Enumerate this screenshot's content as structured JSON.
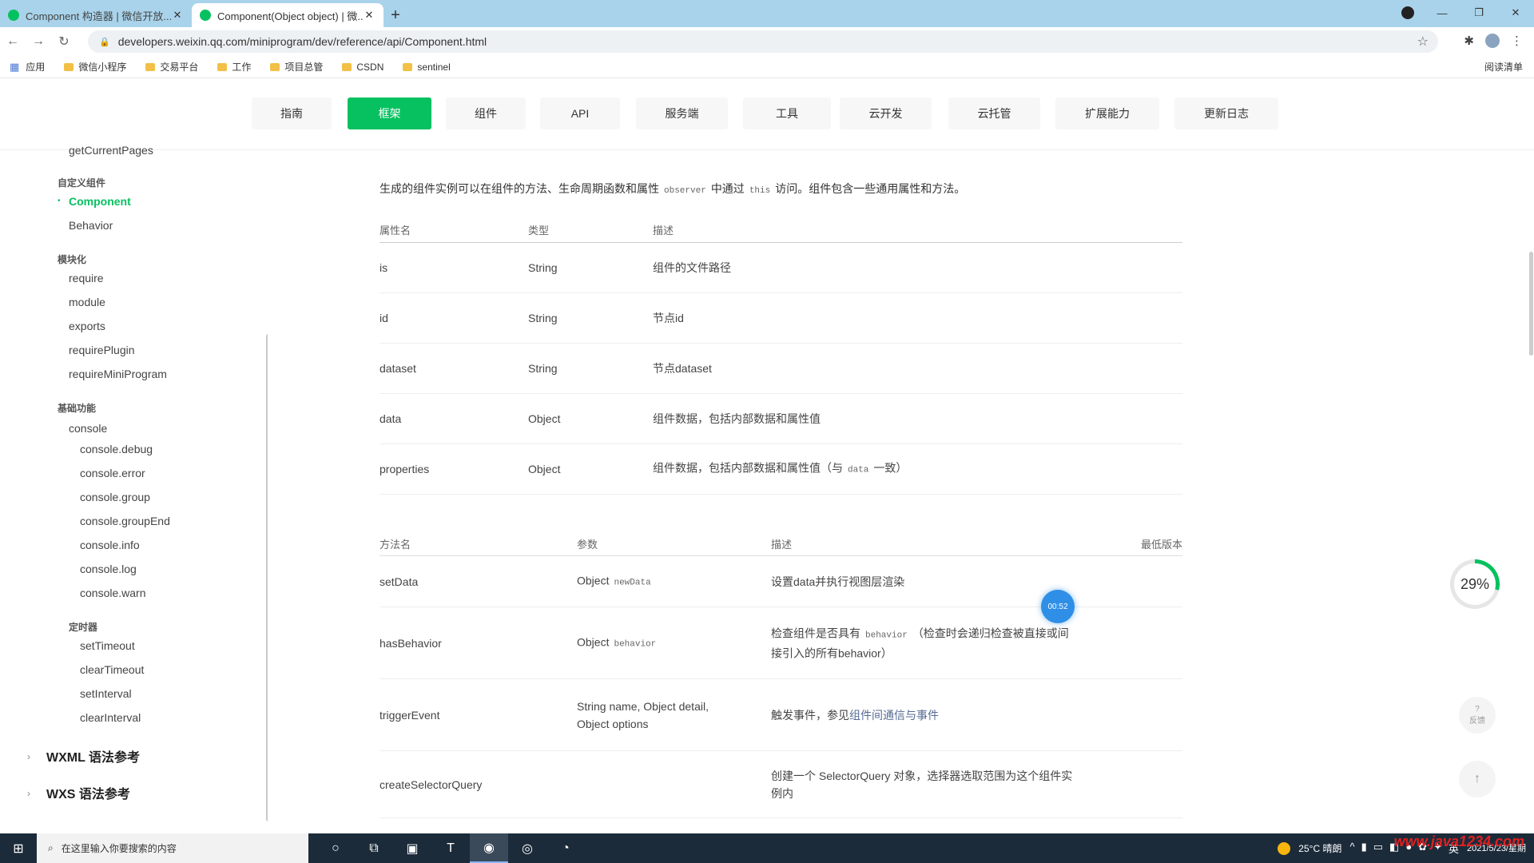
{
  "browser": {
    "tabs": [
      {
        "title": "Component 构造器 | 微信开放...",
        "active": false
      },
      {
        "title": "Component(Object object) | 微...",
        "active": true
      }
    ],
    "url": "developers.weixin.qq.com/miniprogram/dev/reference/api/Component.html",
    "bookmarks": [
      "应用",
      "微信小程序",
      "交易平台",
      "工作",
      "项目总管",
      "CSDN",
      "sentinel"
    ],
    "reading_list": "阅读清单",
    "new_tab": "+"
  },
  "site_nav": {
    "items": [
      {
        "label": "指南",
        "active": false
      },
      {
        "label": "框架",
        "active": true
      },
      {
        "label": "组件",
        "active": false
      },
      {
        "label": "API",
        "active": false
      },
      {
        "label": "服务端",
        "active": false
      },
      {
        "label": "工具",
        "active": false
      },
      {
        "label": "云开发",
        "active": false
      },
      {
        "label": "云托管",
        "active": false
      },
      {
        "label": "扩展能力",
        "active": false
      },
      {
        "label": "更新日志",
        "active": false
      }
    ]
  },
  "sidebar": {
    "items": [
      {
        "label": "getCurrentPages",
        "kind": "item"
      },
      {
        "label": "自定义组件",
        "kind": "group"
      },
      {
        "label": "Component",
        "kind": "active"
      },
      {
        "label": "Behavior",
        "kind": "item"
      },
      {
        "label": "模块化",
        "kind": "group"
      },
      {
        "label": "require",
        "kind": "item"
      },
      {
        "label": "module",
        "kind": "item"
      },
      {
        "label": "exports",
        "kind": "item"
      },
      {
        "label": "requirePlugin",
        "kind": "item"
      },
      {
        "label": "requireMiniProgram",
        "kind": "item"
      },
      {
        "label": "基础功能",
        "kind": "group"
      },
      {
        "label": "console",
        "kind": "item"
      },
      {
        "label": "console.debug",
        "kind": "sub"
      },
      {
        "label": "console.error",
        "kind": "sub"
      },
      {
        "label": "console.group",
        "kind": "sub"
      },
      {
        "label": "console.groupEnd",
        "kind": "sub"
      },
      {
        "label": "console.info",
        "kind": "sub"
      },
      {
        "label": "console.log",
        "kind": "sub"
      },
      {
        "label": "console.warn",
        "kind": "sub"
      },
      {
        "label": "定时器",
        "kind": "subgroup"
      },
      {
        "label": "setTimeout",
        "kind": "sub"
      },
      {
        "label": "clearTimeout",
        "kind": "sub"
      },
      {
        "label": "setInterval",
        "kind": "sub"
      },
      {
        "label": "clearInterval",
        "kind": "sub"
      }
    ],
    "sections": [
      {
        "label": "WXML 语法参考"
      },
      {
        "label": "WXS 语法参考"
      }
    ]
  },
  "main": {
    "intro_before": "生成的组件实例可以在组件的方法、生命周期函数和属性",
    "intro_code1": "observer",
    "intro_mid": "中通过",
    "intro_code2": "this",
    "intro_after": "访问。组件包含一些通用属性和方法。",
    "props_headers": [
      "属性名",
      "类型",
      "描述"
    ],
    "props_rows": [
      {
        "name": "is",
        "type": "String",
        "desc": "组件的文件路径",
        "code": "",
        "desc2": ""
      },
      {
        "name": "id",
        "type": "String",
        "desc": "节点id",
        "code": "",
        "desc2": ""
      },
      {
        "name": "dataset",
        "type": "String",
        "desc": "节点dataset",
        "code": "",
        "desc2": ""
      },
      {
        "name": "data",
        "type": "Object",
        "desc": "组件数据，包括内部数据和属性值",
        "code": "",
        "desc2": ""
      },
      {
        "name": "properties",
        "type": "Object",
        "desc": "组件数据，包括内部数据和属性值（与",
        "code": "data",
        "desc2": "一致）"
      }
    ],
    "methods_headers": [
      "方法名",
      "参数",
      "描述",
      "最低版本"
    ],
    "methods_rows": [
      {
        "name": "setData",
        "params": "Object",
        "params_code": "newData",
        "desc": "设置data并执行视图层渲染",
        "desc_code": "",
        "desc_after": "",
        "desc_link": ""
      },
      {
        "name": "hasBehavior",
        "params": "Object",
        "params_code": "behavior",
        "desc": "检查组件是否具有",
        "desc_code": "behavior",
        "desc_after": "（检查时会递归检查被直接或间接引入的所有behavior）",
        "desc_link": ""
      },
      {
        "name": "triggerEvent",
        "params": "String name, Object detail, Object options",
        "params_code": "",
        "desc": "触发事件，参见",
        "desc_code": "",
        "desc_after": "",
        "desc_link": "组件间通信与事件"
      },
      {
        "name": "createSelectorQuery",
        "params": "",
        "params_code": "",
        "desc": "创建一个 SelectorQuery 对象，选择器选取范围为这个组件实例内",
        "desc_code": "",
        "desc_after": "",
        "desc_link": ""
      }
    ]
  },
  "widgets": {
    "cursor_bubble": "00:52",
    "progress_text": "29%",
    "progress_value": 0.29,
    "help_label": "反馈"
  },
  "taskbar": {
    "search_placeholder": "在这里输入你要搜索的内容",
    "weather": "25°C 晴朗",
    "date": "2021/5/23/星期"
  },
  "watermark": "www.java1234.com",
  "colors": {
    "accent": "#07c160",
    "tabstrip": "#a9d3eb",
    "link": "#576b95"
  }
}
